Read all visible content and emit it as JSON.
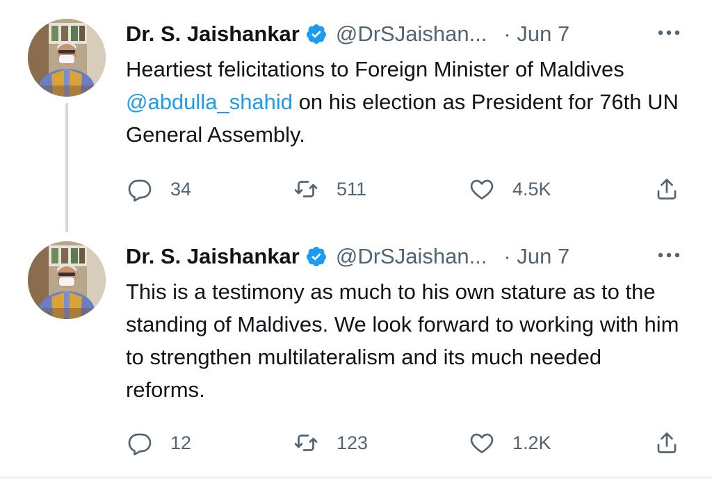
{
  "colors": {
    "text": "#0f1419",
    "secondary": "#536471",
    "link": "#1d9bf0",
    "verified": "#1d9bf0",
    "thread_line": "#cfd9de"
  },
  "tweets": [
    {
      "author": {
        "name": "Dr. S. Jaishankar",
        "verified_icon": "verified-badge-icon",
        "handle": "@DrSJaishan...",
        "avatar_icon": "profile-photo"
      },
      "separator": "·",
      "date": "Jun 7",
      "text": {
        "before": "Heartiest felicitations to Foreign Minister of Maldives ",
        "mention": "@abdulla_shahid",
        "after": " on his election as President for 76th UN General Assembly."
      },
      "stats": {
        "replies": "34",
        "retweets": "511",
        "likes": "4.5K"
      }
    },
    {
      "author": {
        "name": "Dr. S. Jaishankar",
        "verified_icon": "verified-badge-icon",
        "handle": "@DrSJaishan...",
        "avatar_icon": "profile-photo"
      },
      "separator": "·",
      "date": "Jun 7",
      "text": {
        "body": "This is a testimony as much to his own stature as to the standing of Maldives. We look forward to working with him to strengthen multilateralism and its much needed reforms."
      },
      "stats": {
        "replies": "12",
        "retweets": "123",
        "likes": "1.2K"
      }
    }
  ]
}
